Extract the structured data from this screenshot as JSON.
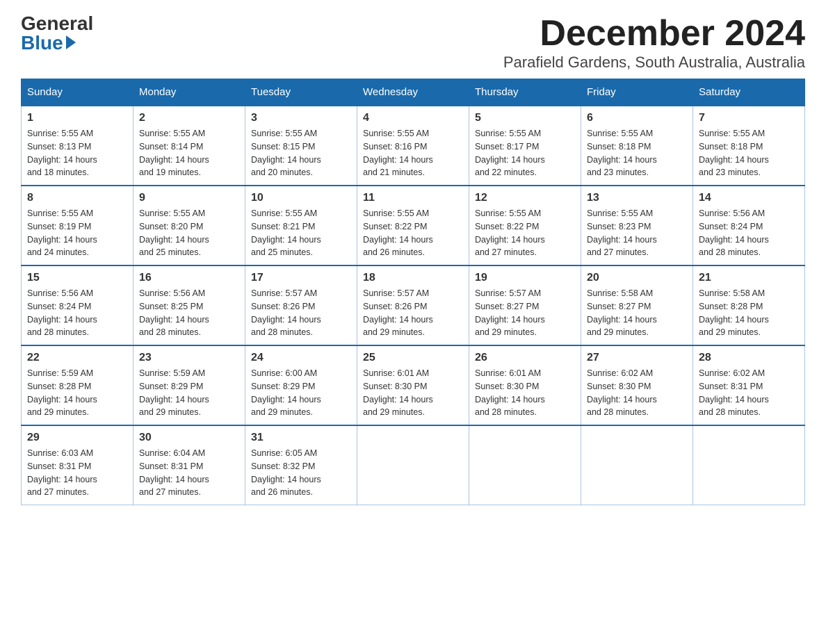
{
  "logo": {
    "general": "General",
    "blue": "Blue"
  },
  "title": "December 2024",
  "subtitle": "Parafield Gardens, South Australia, Australia",
  "days_of_week": [
    "Sunday",
    "Monday",
    "Tuesday",
    "Wednesday",
    "Thursday",
    "Friday",
    "Saturday"
  ],
  "weeks": [
    [
      {
        "day": "1",
        "sunrise": "5:55 AM",
        "sunset": "8:13 PM",
        "daylight": "14 hours and 18 minutes."
      },
      {
        "day": "2",
        "sunrise": "5:55 AM",
        "sunset": "8:14 PM",
        "daylight": "14 hours and 19 minutes."
      },
      {
        "day": "3",
        "sunrise": "5:55 AM",
        "sunset": "8:15 PM",
        "daylight": "14 hours and 20 minutes."
      },
      {
        "day": "4",
        "sunrise": "5:55 AM",
        "sunset": "8:16 PM",
        "daylight": "14 hours and 21 minutes."
      },
      {
        "day": "5",
        "sunrise": "5:55 AM",
        "sunset": "8:17 PM",
        "daylight": "14 hours and 22 minutes."
      },
      {
        "day": "6",
        "sunrise": "5:55 AM",
        "sunset": "8:18 PM",
        "daylight": "14 hours and 23 minutes."
      },
      {
        "day": "7",
        "sunrise": "5:55 AM",
        "sunset": "8:18 PM",
        "daylight": "14 hours and 23 minutes."
      }
    ],
    [
      {
        "day": "8",
        "sunrise": "5:55 AM",
        "sunset": "8:19 PM",
        "daylight": "14 hours and 24 minutes."
      },
      {
        "day": "9",
        "sunrise": "5:55 AM",
        "sunset": "8:20 PM",
        "daylight": "14 hours and 25 minutes."
      },
      {
        "day": "10",
        "sunrise": "5:55 AM",
        "sunset": "8:21 PM",
        "daylight": "14 hours and 25 minutes."
      },
      {
        "day": "11",
        "sunrise": "5:55 AM",
        "sunset": "8:22 PM",
        "daylight": "14 hours and 26 minutes."
      },
      {
        "day": "12",
        "sunrise": "5:55 AM",
        "sunset": "8:22 PM",
        "daylight": "14 hours and 27 minutes."
      },
      {
        "day": "13",
        "sunrise": "5:55 AM",
        "sunset": "8:23 PM",
        "daylight": "14 hours and 27 minutes."
      },
      {
        "day": "14",
        "sunrise": "5:56 AM",
        "sunset": "8:24 PM",
        "daylight": "14 hours and 28 minutes."
      }
    ],
    [
      {
        "day": "15",
        "sunrise": "5:56 AM",
        "sunset": "8:24 PM",
        "daylight": "14 hours and 28 minutes."
      },
      {
        "day": "16",
        "sunrise": "5:56 AM",
        "sunset": "8:25 PM",
        "daylight": "14 hours and 28 minutes."
      },
      {
        "day": "17",
        "sunrise": "5:57 AM",
        "sunset": "8:26 PM",
        "daylight": "14 hours and 28 minutes."
      },
      {
        "day": "18",
        "sunrise": "5:57 AM",
        "sunset": "8:26 PM",
        "daylight": "14 hours and 29 minutes."
      },
      {
        "day": "19",
        "sunrise": "5:57 AM",
        "sunset": "8:27 PM",
        "daylight": "14 hours and 29 minutes."
      },
      {
        "day": "20",
        "sunrise": "5:58 AM",
        "sunset": "8:27 PM",
        "daylight": "14 hours and 29 minutes."
      },
      {
        "day": "21",
        "sunrise": "5:58 AM",
        "sunset": "8:28 PM",
        "daylight": "14 hours and 29 minutes."
      }
    ],
    [
      {
        "day": "22",
        "sunrise": "5:59 AM",
        "sunset": "8:28 PM",
        "daylight": "14 hours and 29 minutes."
      },
      {
        "day": "23",
        "sunrise": "5:59 AM",
        "sunset": "8:29 PM",
        "daylight": "14 hours and 29 minutes."
      },
      {
        "day": "24",
        "sunrise": "6:00 AM",
        "sunset": "8:29 PM",
        "daylight": "14 hours and 29 minutes."
      },
      {
        "day": "25",
        "sunrise": "6:01 AM",
        "sunset": "8:30 PM",
        "daylight": "14 hours and 29 minutes."
      },
      {
        "day": "26",
        "sunrise": "6:01 AM",
        "sunset": "8:30 PM",
        "daylight": "14 hours and 28 minutes."
      },
      {
        "day": "27",
        "sunrise": "6:02 AM",
        "sunset": "8:30 PM",
        "daylight": "14 hours and 28 minutes."
      },
      {
        "day": "28",
        "sunrise": "6:02 AM",
        "sunset": "8:31 PM",
        "daylight": "14 hours and 28 minutes."
      }
    ],
    [
      {
        "day": "29",
        "sunrise": "6:03 AM",
        "sunset": "8:31 PM",
        "daylight": "14 hours and 27 minutes."
      },
      {
        "day": "30",
        "sunrise": "6:04 AM",
        "sunset": "8:31 PM",
        "daylight": "14 hours and 27 minutes."
      },
      {
        "day": "31",
        "sunrise": "6:05 AM",
        "sunset": "8:32 PM",
        "daylight": "14 hours and 26 minutes."
      },
      null,
      null,
      null,
      null
    ]
  ],
  "labels": {
    "sunrise": "Sunrise:",
    "sunset": "Sunset:",
    "daylight": "Daylight:"
  }
}
